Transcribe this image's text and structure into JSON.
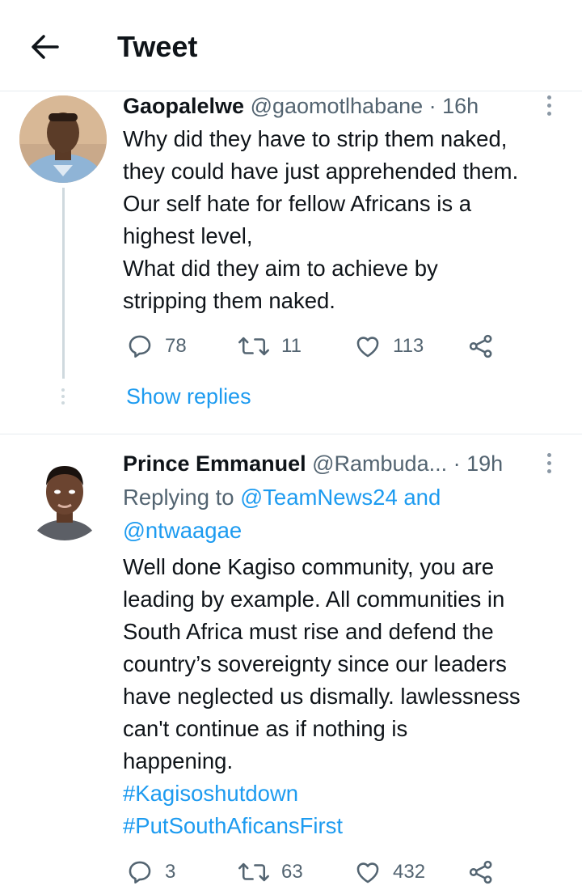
{
  "header": {
    "title": "Tweet"
  },
  "tweets": [
    {
      "display_name": "Gaopalelwe",
      "handle": "@gaomotlhabane",
      "time": "· 16h",
      "text": "Why did they have to strip them naked,\nthey could have just apprehended them.\nOur self hate for fellow Africans is a\nhighest level,\nWhat did they aim to achieve by\nstripping them naked.",
      "replies": "78",
      "retweets": "11",
      "likes": "113"
    },
    {
      "display_name": "Prince Emmanuel",
      "handle": "@Rambuda...",
      "time": "· 19h",
      "replying_prefix": "Replying to ",
      "replying_to_1": "@TeamNews24",
      "replying_and": " and",
      "replying_to_2": "@ntwaagae",
      "text": "Well done Kagiso community, you are\nleading by example. All communities in\nSouth Africa must rise and defend the\ncountry’s sovereignty since our leaders\nhave neglected us dismally. lawlessness\ncan't continue as if nothing is\nhappening.",
      "hashtags": [
        "#Kagisoshutdown",
        "#PutSouthAficansFirst"
      ],
      "replies": "3",
      "retweets": "63",
      "likes": "432"
    }
  ],
  "show_replies": "Show replies",
  "colors": {
    "accent": "#1d9bf0",
    "text": "#0f1419",
    "muted": "#536471",
    "divider": "#e6ebef"
  },
  "icons": [
    "back-arrow-icon",
    "more-vertical-icon",
    "reply-icon",
    "retweet-icon",
    "like-icon",
    "share-icon"
  ]
}
